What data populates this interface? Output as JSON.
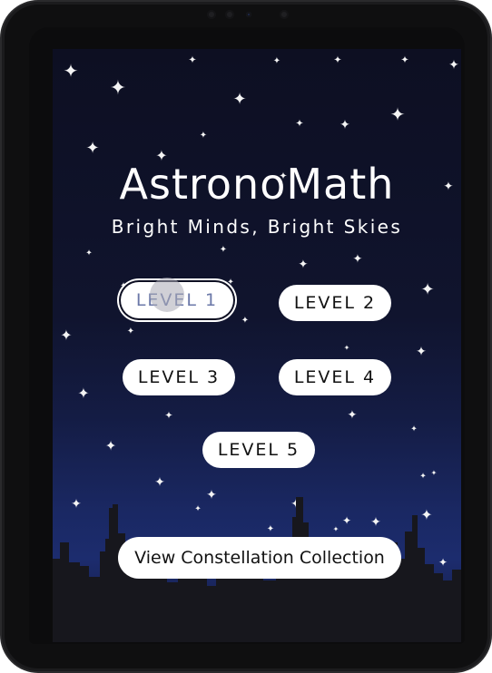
{
  "app": {
    "title": "AstronoMath",
    "subtitle": "Bright Minds, Bright Skies"
  },
  "levels": [
    {
      "label": "LEVEL 1",
      "selected": true
    },
    {
      "label": "LEVEL 2",
      "selected": false
    },
    {
      "label": "LEVEL 3",
      "selected": false
    },
    {
      "label": "LEVEL 4",
      "selected": false
    },
    {
      "label": "LEVEL 5",
      "selected": false
    }
  ],
  "collection_button": {
    "label": "View Constellation Collection"
  },
  "colors": {
    "sky_top": "#0d0f22",
    "sky_horizon": "#1c2c6e",
    "button_bg": "#ffffff",
    "button_text": "#111111",
    "selected_text": "#6b78a8"
  },
  "icons": {
    "star": "four-point-star-icon",
    "skyline": "city-skyline-silhouette"
  }
}
